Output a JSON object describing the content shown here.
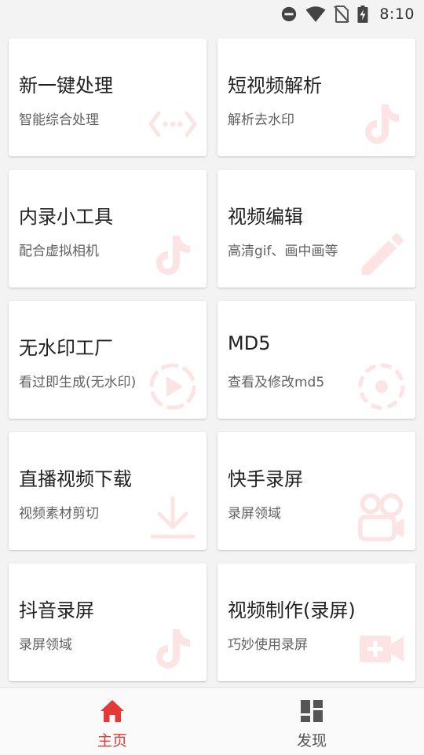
{
  "status_bar": {
    "time": "8:10",
    "icons": [
      "do-not-disturb-icon",
      "wifi-icon",
      "no-sim-icon",
      "battery-charging-icon"
    ]
  },
  "colors": {
    "accent": "#e53935",
    "icon_faded": "#fde4e4",
    "inactive": "#555555"
  },
  "cards": [
    {
      "title": "新一键处理",
      "subtitle": "智能综合处理",
      "icon": "code-arrows-icon"
    },
    {
      "title": "短视频解析",
      "subtitle": "解析去水印",
      "icon": "tiktok-icon"
    },
    {
      "title": "内录小工具",
      "subtitle": "配合虚拟相机",
      "icon": "tiktok-icon"
    },
    {
      "title": "视频编辑",
      "subtitle": "高清gif、画中画等",
      "icon": "pencil-icon"
    },
    {
      "title": "无水印工厂",
      "subtitle": "看过即生成(无水印)",
      "icon": "play-circle-icon"
    },
    {
      "title": "MD5",
      "subtitle": "查看及修改md5",
      "icon": "target-circle-icon"
    },
    {
      "title": "直播视频下载",
      "subtitle": "视频素材剪切",
      "icon": "download-icon"
    },
    {
      "title": "快手录屏",
      "subtitle": "录屏领域",
      "icon": "kuaishou-icon"
    },
    {
      "title": "抖音录屏",
      "subtitle": "录屏领域",
      "icon": "tiktok-icon"
    },
    {
      "title": "视频制作(录屏)",
      "subtitle": "巧妙使用录屏",
      "icon": "video-add-icon"
    }
  ],
  "bottom_nav": {
    "items": [
      {
        "label": "主页",
        "icon": "home-icon",
        "active": true
      },
      {
        "label": "发现",
        "icon": "dashboard-icon",
        "active": false
      }
    ]
  }
}
